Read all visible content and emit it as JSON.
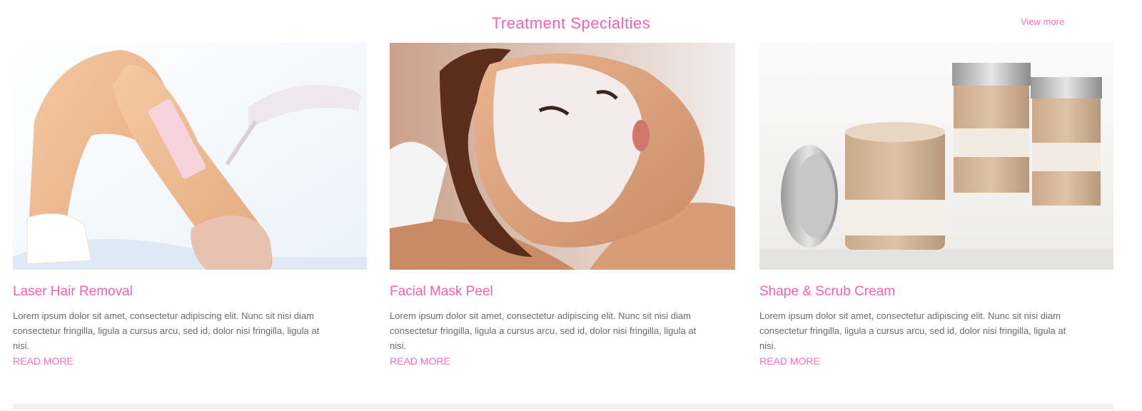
{
  "section": {
    "title": "Treatment Specialties",
    "view_all_label": "View more"
  },
  "cards": [
    {
      "title": "Laser Hair Removal",
      "description": "Lorem ipsum dolor sit amet, consectetur adipiscing elit. Nunc sit nisi diam consectetur fringilla, ligula a cursus arcu, sed id, dolor nisi fringilla, ligula at nisi.",
      "link_label": "READ MORE",
      "image_icon": "waxing-leg-image"
    },
    {
      "title": "Facial Mask Peel",
      "description": "Lorem ipsum dolor sit amet, consectetur adipiscing elit. Nunc sit nisi diam consectetur fringilla, ligula a cursus arcu, sed id, dolor nisi fringilla, ligula at nisi.",
      "link_label": "READ MORE",
      "image_icon": "facial-mask-image"
    },
    {
      "title": "Shape & Scrub Cream",
      "description": "Lorem ipsum dolor sit amet, consectetur adipiscing elit. Nunc sit nisi diam consectetur fringilla, ligula a cursus arcu, sed id, dolor nisi fringilla, ligula at nisi.",
      "link_label": "READ MORE",
      "image_icon": "cream-jars-image"
    }
  ],
  "colors": {
    "accent": "#ff5fb0",
    "body_text": "#6a6a6a"
  }
}
